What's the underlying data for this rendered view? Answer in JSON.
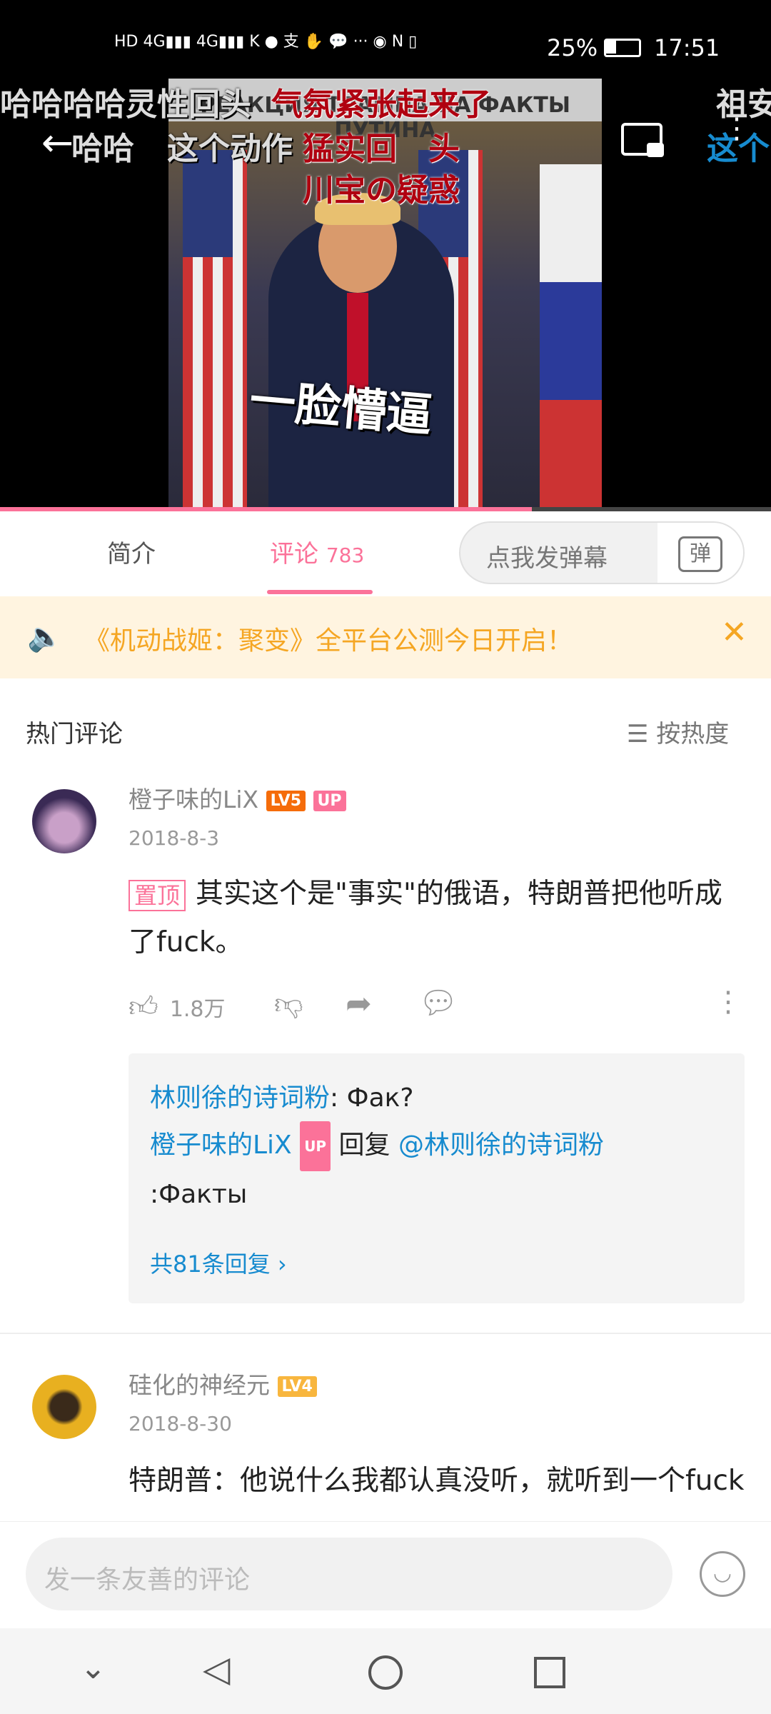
{
  "status_bar": {
    "time": "17:51",
    "battery": "25%"
  },
  "video": {
    "danmaku": [
      "哈哈哈哈灵性回头",
      "气氛紧张起来了",
      "祖安",
      "哈哈",
      "这个动作",
      "猛实回　头",
      "川宝の疑惑",
      "这个"
    ],
    "banner_text": "РЕАКЦИЯ ТРАМПА НА ФАКТЫ ПУТИНА",
    "subtitle": "一脸懵逼",
    "progress_percent": 69
  },
  "tabs": {
    "intro": "简介",
    "comments": "评论",
    "comment_count": "783",
    "danmaku_placeholder": "点我发弹幕",
    "danmaku_button": "弹"
  },
  "notice": {
    "text": "《机动战姬：聚变》全平台公测今日开启！"
  },
  "section": {
    "title": "热门评论",
    "sort": "按热度"
  },
  "comments": [
    {
      "name": "橙子味的LiX",
      "level": "LV5",
      "up": "UP",
      "date": "2018-8-3",
      "pinned": "置顶",
      "text": "其实这个是\"事实\"的俄语，特朗普把他听成了fuck。",
      "likes": "1.8万",
      "replies": [
        {
          "user": "林则徐的诗词粉",
          "text": ": Фак?"
        },
        {
          "user": "橙子味的LiX",
          "up": "UP",
          "verb": " 回复 ",
          "target": "@林则徐的诗词粉",
          "text": " :Факты"
        }
      ],
      "more_replies": "共81条回复"
    },
    {
      "name": "硅化的神经元",
      "level": "LV4",
      "date": "2018-8-30",
      "text": "特朗普：他说什么我都认真没听，就听到一个fuck"
    }
  ],
  "composer": {
    "placeholder": "发一条友善的评论"
  },
  "colors": {
    "accent": "#fb7299",
    "link": "#178bcf",
    "notice": "#f5a623",
    "lv5": "#f56c0a",
    "lv4": "#f8b63e"
  }
}
